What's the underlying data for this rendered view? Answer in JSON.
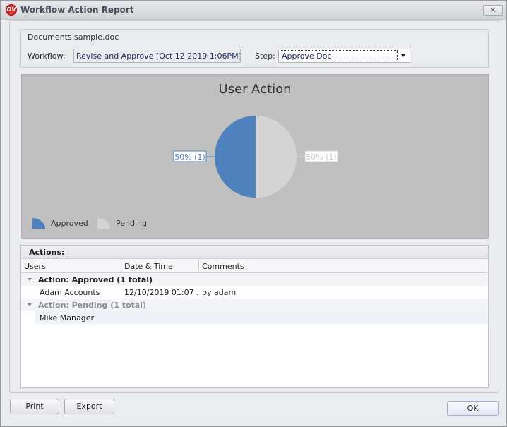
{
  "window": {
    "title": "Workflow Action Report",
    "logo_text": "DV",
    "close_label": "✕"
  },
  "details": {
    "documents_label": "Documents:",
    "documents_value": "sample.doc",
    "workflow_label": "Workflow:",
    "workflow_value": "Revise and Approve [Oct 12 2019  1:06PM]",
    "step_label": "Step:",
    "step_value": "Approve Doc"
  },
  "chart_data": {
    "type": "pie",
    "title": "User Action",
    "categories": [
      "Approved",
      "Pending"
    ],
    "values": [
      1,
      1
    ],
    "labels": [
      "50% (1)",
      "50% (1)"
    ],
    "colors": [
      "#4f81bd",
      "#d4d4d4"
    ],
    "legend": "bottom-left"
  },
  "actions": {
    "title": "Actions:",
    "columns": [
      "Users",
      "Date & Time",
      "Comments"
    ],
    "groups": [
      {
        "label": "Action:  Approved (1 total)",
        "rows": [
          {
            "user": "Adam Accounts",
            "datetime": "12/10/2019 01:07 ...",
            "comment": "by adam"
          }
        ]
      },
      {
        "label": "Action: Pending (1 total)",
        "rows": [
          {
            "user": "Mike Manager",
            "datetime": "",
            "comment": ""
          }
        ]
      }
    ]
  },
  "buttons": {
    "print": "Print",
    "export": "Export",
    "ok": "OK"
  }
}
